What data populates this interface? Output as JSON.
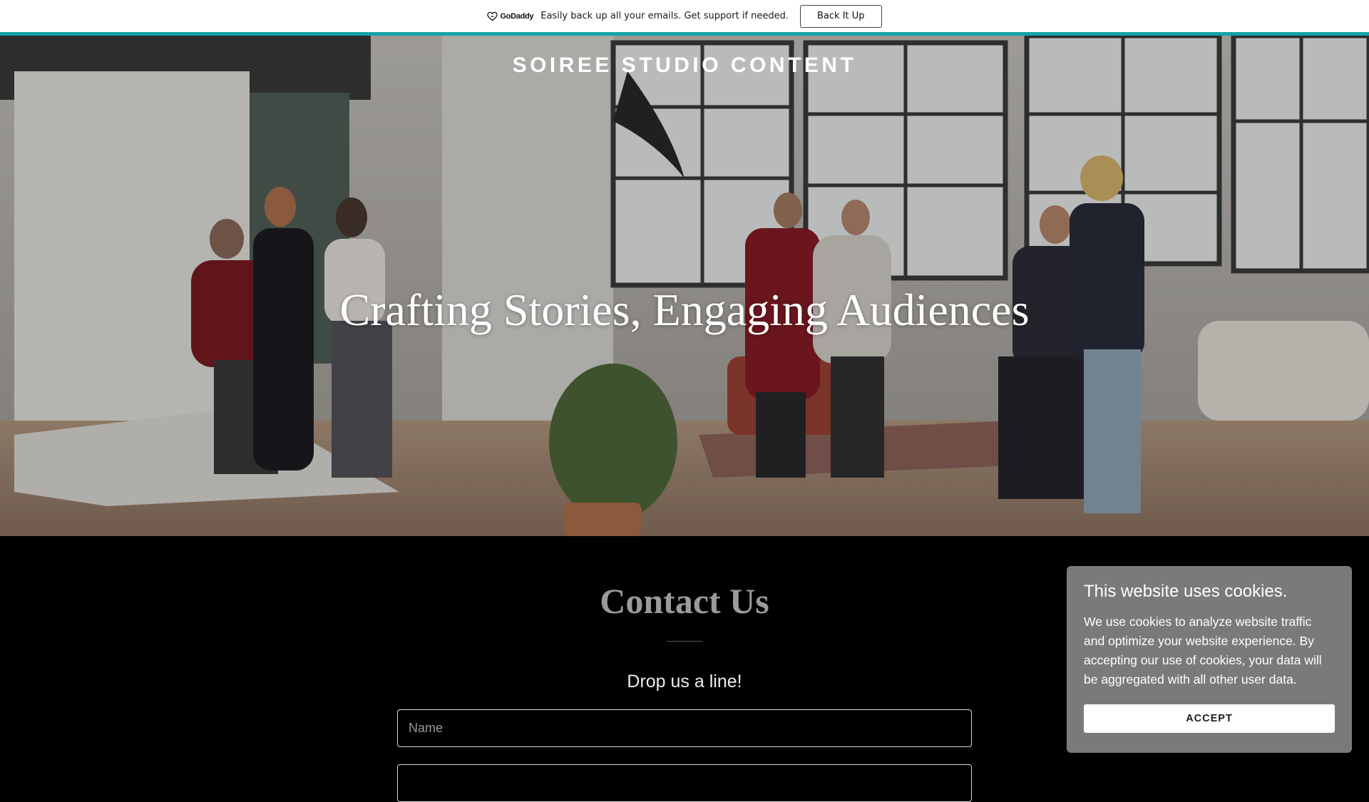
{
  "promo": {
    "logo_text": "GoDaddy",
    "message": "Easily back up all your emails. Get support if needed.",
    "button_label": "Back It Up"
  },
  "colors": {
    "accent": "#14a3a8",
    "background": "#000000",
    "cookie_banner": "#7a7a7a"
  },
  "hero": {
    "site_title": "SOIREE STUDIO CONTENT",
    "headline": "Crafting Stories, Engaging Audiences"
  },
  "contact": {
    "heading": "Contact Us",
    "subheading": "Drop us a line!",
    "name_placeholder": "Name"
  },
  "cookie": {
    "title": "This website uses cookies.",
    "text": "We use cookies to analyze website traffic and optimize your website experience. By accepting our use of cookies, your data will be aggregated with all other user data.",
    "accept_label": "ACCEPT"
  }
}
